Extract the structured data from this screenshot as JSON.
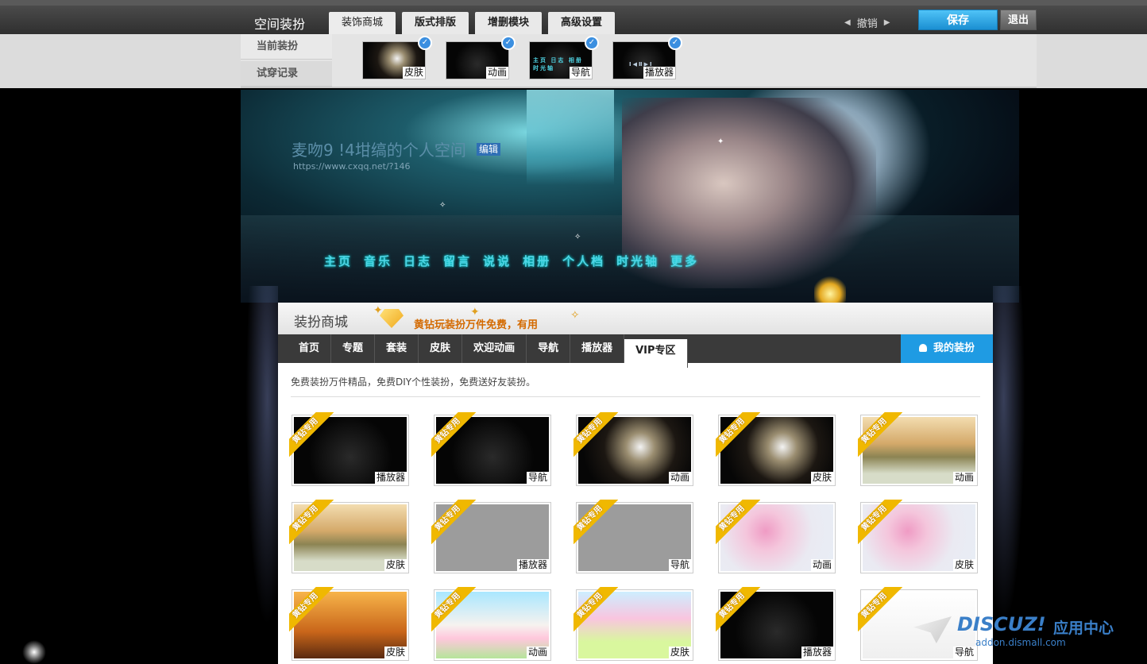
{
  "topbar": {
    "title": "空间装扮",
    "tabs": [
      "装饰商城",
      "版式排版",
      "增删模块",
      "高级设置"
    ],
    "undo_label": "撤销",
    "save_label": "保存",
    "exit_label": "退出"
  },
  "subbar": {
    "menu": [
      "当前装扮",
      "试穿记录"
    ],
    "current": [
      {
        "label": "皮肤",
        "theme": "t-dand"
      },
      {
        "label": "动画",
        "theme": "t-dark"
      },
      {
        "label": "导航",
        "theme": "t-dark"
      },
      {
        "label": "播放器",
        "theme": "t-dark"
      }
    ]
  },
  "banner": {
    "space_name": "麦吻9 !4坩缟的个人空间",
    "edit_label": "编辑",
    "url": "https://www.cxqq.net/?146",
    "nav": [
      "主页",
      "音乐",
      "日志",
      "留言",
      "说说",
      "相册",
      "个人档",
      "时光轴",
      "更多"
    ]
  },
  "store": {
    "title": "装扮商城",
    "promo": "黄钻玩装扮万件免费，有用",
    "categories": [
      "首页",
      "专题",
      "套装",
      "皮肤",
      "欢迎动画",
      "导航",
      "播放器",
      "VIP专区"
    ],
    "active_category": "VIP专区",
    "my_button": "我的装扮",
    "description": "免费装扮万件精品，免费DIY个性装扮，免费送好友装扮。",
    "ribbon": "黄钻专用",
    "items": [
      {
        "label": "播放器",
        "theme": "t-dark"
      },
      {
        "label": "导航",
        "theme": "t-dark"
      },
      {
        "label": "动画",
        "theme": "t-dand"
      },
      {
        "label": "皮肤",
        "theme": "t-dand"
      },
      {
        "label": "动画",
        "theme": "t-field"
      },
      {
        "label": "皮肤",
        "theme": "t-field"
      },
      {
        "label": "播放器",
        "theme": "t-gray"
      },
      {
        "label": "导航",
        "theme": "t-gray"
      },
      {
        "label": "动画",
        "theme": "t-blossom"
      },
      {
        "label": "皮肤",
        "theme": "t-blossom"
      },
      {
        "label": "皮肤",
        "theme": "t-cat"
      },
      {
        "label": "动画",
        "theme": "t-windmill"
      },
      {
        "label": "皮肤",
        "theme": "t-kite"
      },
      {
        "label": "播放器",
        "theme": "t-dark"
      },
      {
        "label": "导航",
        "theme": "t-white"
      }
    ]
  },
  "watermark": {
    "logo": "DISCUZ!",
    "logo_cn": "应用中心",
    "sub": "addon.dismall.com"
  }
}
